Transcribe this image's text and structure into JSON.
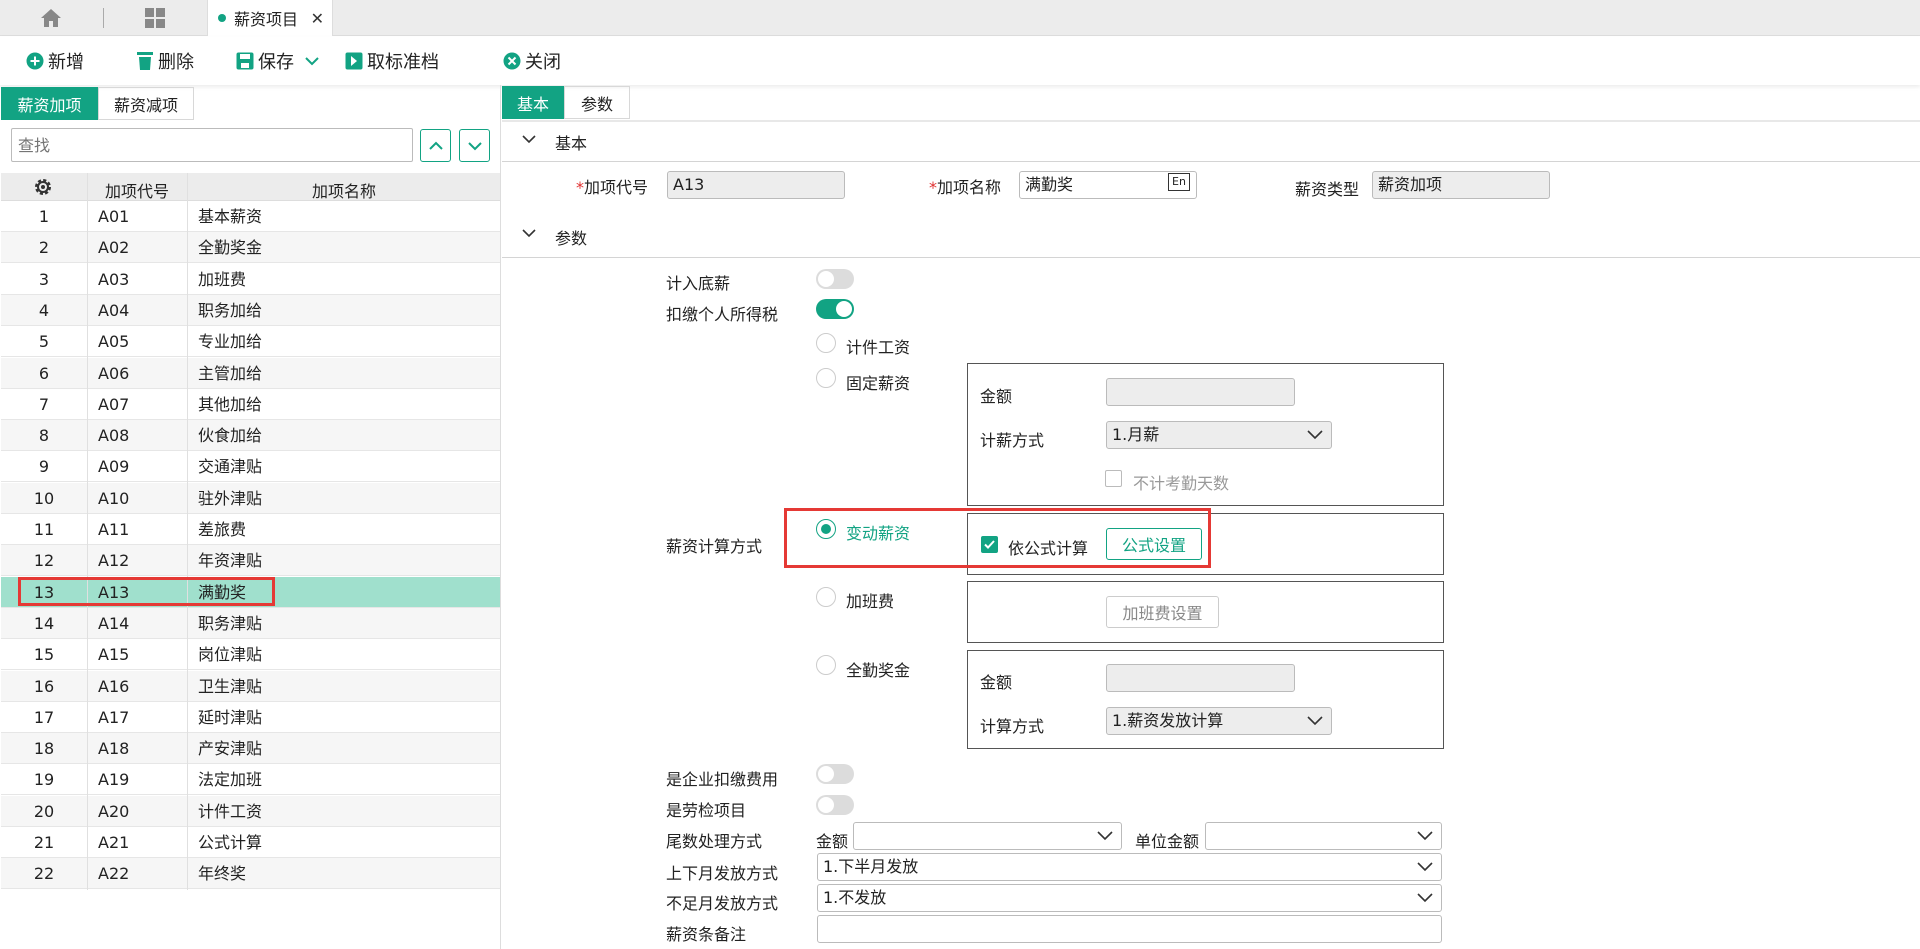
{
  "top_tabs": {
    "page_tab_label": "薪资项目"
  },
  "toolbar": {
    "add": "新增",
    "delete": "删除",
    "save": "保存",
    "cancel_approve": "取标准档",
    "close": "关闭"
  },
  "left": {
    "tabs": [
      "薪资加项",
      "薪资减项"
    ],
    "search_placeholder": "查找",
    "headers": {
      "code": "加项代号",
      "name": "加项名称"
    },
    "rows": [
      {
        "no": "1",
        "code": "A01",
        "name": "基本薪资"
      },
      {
        "no": "2",
        "code": "A02",
        "name": "全勤奖金"
      },
      {
        "no": "3",
        "code": "A03",
        "name": "加班费"
      },
      {
        "no": "4",
        "code": "A04",
        "name": "职务加给"
      },
      {
        "no": "5",
        "code": "A05",
        "name": "专业加给"
      },
      {
        "no": "6",
        "code": "A06",
        "name": "主管加给"
      },
      {
        "no": "7",
        "code": "A07",
        "name": "其他加给"
      },
      {
        "no": "8",
        "code": "A08",
        "name": "伙食加给"
      },
      {
        "no": "9",
        "code": "A09",
        "name": "交通津贴"
      },
      {
        "no": "10",
        "code": "A10",
        "name": "驻外津贴"
      },
      {
        "no": "11",
        "code": "A11",
        "name": "差旅费"
      },
      {
        "no": "12",
        "code": "A12",
        "name": "年资津贴"
      },
      {
        "no": "13",
        "code": "A13",
        "name": "满勤奖"
      },
      {
        "no": "14",
        "code": "A14",
        "name": "职务津贴"
      },
      {
        "no": "15",
        "code": "A15",
        "name": "岗位津贴"
      },
      {
        "no": "16",
        "code": "A16",
        "name": "卫生津贴"
      },
      {
        "no": "17",
        "code": "A17",
        "name": "延时津贴"
      },
      {
        "no": "18",
        "code": "A18",
        "name": "产安津贴"
      },
      {
        "no": "19",
        "code": "A19",
        "name": "法定加班"
      },
      {
        "no": "20",
        "code": "A20",
        "name": "计件工资"
      },
      {
        "no": "21",
        "code": "A21",
        "name": "公式计算"
      },
      {
        "no": "22",
        "code": "A22",
        "name": "年终奖"
      }
    ],
    "selected_index": 12
  },
  "right": {
    "tabs": [
      "基本",
      "参数"
    ],
    "basic_section": "基本",
    "param_section": "参数",
    "fields": {
      "code_label": "加项代号",
      "code_value": "A13",
      "name_label": "加项名称",
      "name_value": "满勤奖",
      "type_label": "薪资类型",
      "type_value": "薪资加项",
      "lang_badge": "En"
    },
    "params": {
      "include_base": "计入底薪",
      "withhold_tax": "扣缴个人所得税",
      "calc_method": "薪资计算方式",
      "piece_wage": "计件工资",
      "fixed_salary": "固定薪资",
      "amount": "金额",
      "pay_method": "计薪方式",
      "pay_method_value": "1.月薪",
      "exclude_attendance": "不计考勤天数",
      "variable_salary": "变动薪资",
      "by_formula": "依公式计算",
      "formula_setting": "公式设置",
      "overtime": "加班费",
      "overtime_setting": "加班费设置",
      "attendance_bonus": "全勤奖金",
      "amount2": "金额",
      "calc_way": "计算方式",
      "calc_way_value": "1.薪资发放计算",
      "company_fee": "是企业扣缴费用",
      "labor_check": "是劳检项目",
      "rounding": "尾数处理方式",
      "rounding_amount": "金额",
      "unit_amount": "单位金额",
      "half_month": "上下月发放方式",
      "half_month_value": "1.下半月发放",
      "short_month": "不足月发放方式",
      "short_month_value": "1.不发放",
      "remark": "薪资条备注"
    }
  },
  "colors": {
    "accent": "#12a383",
    "highlight": "#e53935"
  }
}
